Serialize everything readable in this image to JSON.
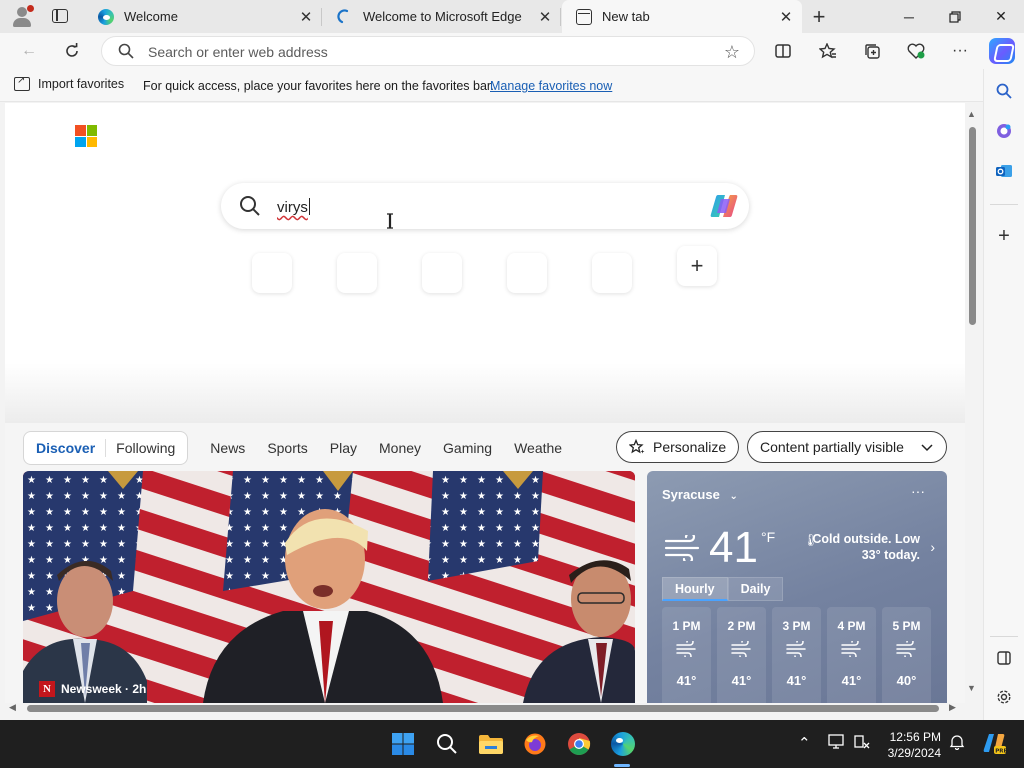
{
  "browser": {
    "tabs": [
      {
        "label": "Welcome",
        "icon": "edge-icon",
        "active": false
      },
      {
        "label": "Welcome to Microsoft Edge",
        "icon": "loading-icon",
        "active": false
      },
      {
        "label": "New tab",
        "icon": "new-tab-icon",
        "active": true
      }
    ],
    "address_placeholder": "Search or enter web address"
  },
  "favorites_bar": {
    "import_label": "Import favorites",
    "message": "For quick access, place your favorites here on the favorites bar.",
    "manage_link": "Manage favorites now"
  },
  "newtab": {
    "search_query": "virys",
    "feed_tabs": [
      {
        "label": "Discover",
        "active": true
      },
      {
        "label": "Following",
        "active": false
      }
    ],
    "nav_links": [
      "News",
      "Sports",
      "Play",
      "Money",
      "Gaming",
      "Weathe"
    ],
    "personalize_label": "Personalize",
    "content_visibility_label": "Content partially visible",
    "hero": {
      "source": "Newsweek · 2h",
      "source_logo": "N"
    }
  },
  "weather": {
    "city": "Syracuse",
    "temp": "41",
    "unit": "°F",
    "summary": "Cold outside. Low 33° today.",
    "tabs": [
      "Hourly",
      "Daily"
    ],
    "hourly": [
      {
        "time": "1 PM",
        "temp": "41°"
      },
      {
        "time": "2 PM",
        "temp": "41°"
      },
      {
        "time": "3 PM",
        "temp": "41°"
      },
      {
        "time": "4 PM",
        "temp": "41°"
      },
      {
        "time": "5 PM",
        "temp": "40°"
      }
    ]
  },
  "taskbar": {
    "time": "12:56 PM",
    "date": "3/29/2024"
  },
  "colors": {
    "accent": "#1a5fb4",
    "taskbar": "#1f1f1f"
  }
}
